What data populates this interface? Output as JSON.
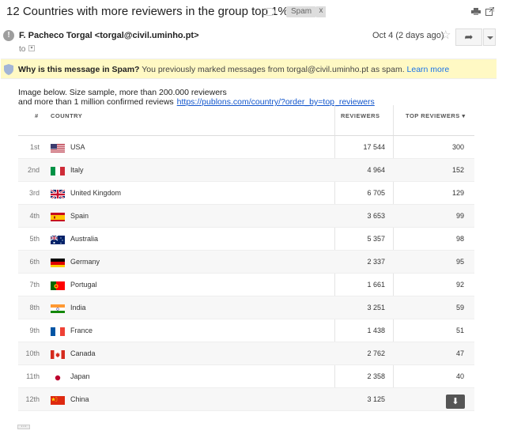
{
  "email": {
    "subject": "12 Countries with more reviewers in the group top 1%",
    "spam_label": "Spam",
    "spam_label_close": "x",
    "sender": "F. Pacheco Torgal <torgal@civil.uminho.pt>",
    "avatar_glyph": "!",
    "to_label": "to",
    "date": "Oct 4 (2 days ago)",
    "banner_bold": "Why is this message in Spam?",
    "banner_text": " You previously marked messages from torgal@civil.uminho.pt as spam.",
    "banner_link": "Learn more",
    "body_line1": "Image below. Size sample, more than 200.000 reviewers",
    "body_line2": "and more than 1 million confirmed reviews",
    "body_link": "https://publons.com/country/?order_by=top_reviewers"
  },
  "table": {
    "headers": {
      "rank": "#",
      "country": "COUNTRY",
      "reviewers": "REVIEWERS",
      "top_reviewers": "TOP REVIEWERS ▾"
    },
    "rows": [
      {
        "rank": "1st",
        "flag": "us-flag",
        "country": "USA",
        "reviewers": "17 544",
        "top": "300"
      },
      {
        "rank": "2nd",
        "flag": "it-flag",
        "country": "Italy",
        "reviewers": "4 964",
        "top": "152"
      },
      {
        "rank": "3rd",
        "flag": "gb-flag",
        "country": "United Kingdom",
        "reviewers": "6 705",
        "top": "129"
      },
      {
        "rank": "4th",
        "flag": "es-flag",
        "country": "Spain",
        "reviewers": "3 653",
        "top": "99"
      },
      {
        "rank": "5th",
        "flag": "au-flag",
        "country": "Australia",
        "reviewers": "5 357",
        "top": "98"
      },
      {
        "rank": "6th",
        "flag": "de-flag",
        "country": "Germany",
        "reviewers": "2 337",
        "top": "95"
      },
      {
        "rank": "7th",
        "flag": "pt-flag",
        "country": "Portugal",
        "reviewers": "1 661",
        "top": "92"
      },
      {
        "rank": "8th",
        "flag": "in-flag",
        "country": "India",
        "reviewers": "3 251",
        "top": "59"
      },
      {
        "rank": "9th",
        "flag": "fr-flag",
        "country": "France",
        "reviewers": "1 438",
        "top": "51"
      },
      {
        "rank": "10th",
        "flag": "ca-flag",
        "country": "Canada",
        "reviewers": "2 762",
        "top": "47"
      },
      {
        "rank": "11th",
        "flag": "jp-flag",
        "country": "Japan",
        "reviewers": "2 358",
        "top": "40"
      },
      {
        "rank": "12th",
        "flag": "cn-flag",
        "country": "China",
        "reviewers": "3 125",
        "top": ""
      }
    ]
  },
  "colors": {
    "banner_bg": "#fff9c4",
    "link": "#1a73e8",
    "download_bg": "#555555"
  }
}
